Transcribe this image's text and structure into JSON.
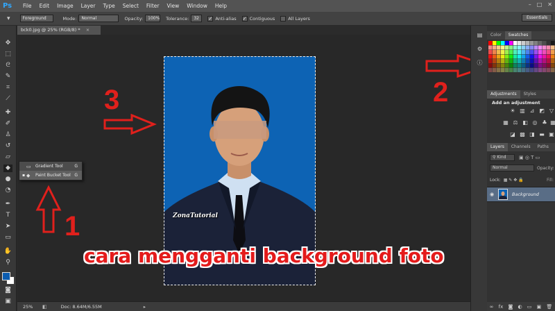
{
  "app": {
    "logo": "Ps"
  },
  "menu": [
    "File",
    "Edit",
    "Image",
    "Layer",
    "Type",
    "Select",
    "Filter",
    "View",
    "Window",
    "Help"
  ],
  "window_controls": [
    "–",
    "□",
    "✕"
  ],
  "options_bar": {
    "fill_source": "Foreground",
    "mode_label": "Mode:",
    "mode_value": "Normal",
    "opacity_label": "Opacity:",
    "opacity_value": "100%",
    "tolerance_label": "Tolerance:",
    "tolerance_value": "32",
    "anti_alias": "Anti-alias",
    "contiguous": "Contiguous",
    "all_layers": "All Layers",
    "workspace": "Essentials"
  },
  "document": {
    "tab_title": "bck0.jpg @ 25% (RGB/8) *",
    "watermark": "ZonaTutorial"
  },
  "flyout": {
    "items": [
      {
        "label": "Gradient Tool",
        "key": "G"
      },
      {
        "label": "Paint Bucket Tool",
        "key": "G"
      }
    ]
  },
  "annotations": {
    "step1": "1",
    "step2": "2",
    "step3": "3",
    "caption": "cara mengganti background foto"
  },
  "statusbar": {
    "zoom": "25%",
    "doc_info": "Doc: 8.64M/6.55M"
  },
  "panels": {
    "color_tabs": [
      "Color",
      "Swatches"
    ],
    "adjustments_tabs": [
      "Adjustments",
      "Styles"
    ],
    "adjustments_title": "Add an adjustment",
    "layers_tabs": [
      "Layers",
      "Channels",
      "Paths"
    ],
    "kind_label": "Kind",
    "blend_mode": "Normal",
    "opacity_label": "Opacity:",
    "lock_label": "Lock:",
    "fill_label": "Fill:",
    "layer_name": "Background"
  },
  "colors": {
    "accent_red": "#e0201c",
    "photo_blue": "#0d63b4",
    "selected_layer": "#596d86"
  }
}
